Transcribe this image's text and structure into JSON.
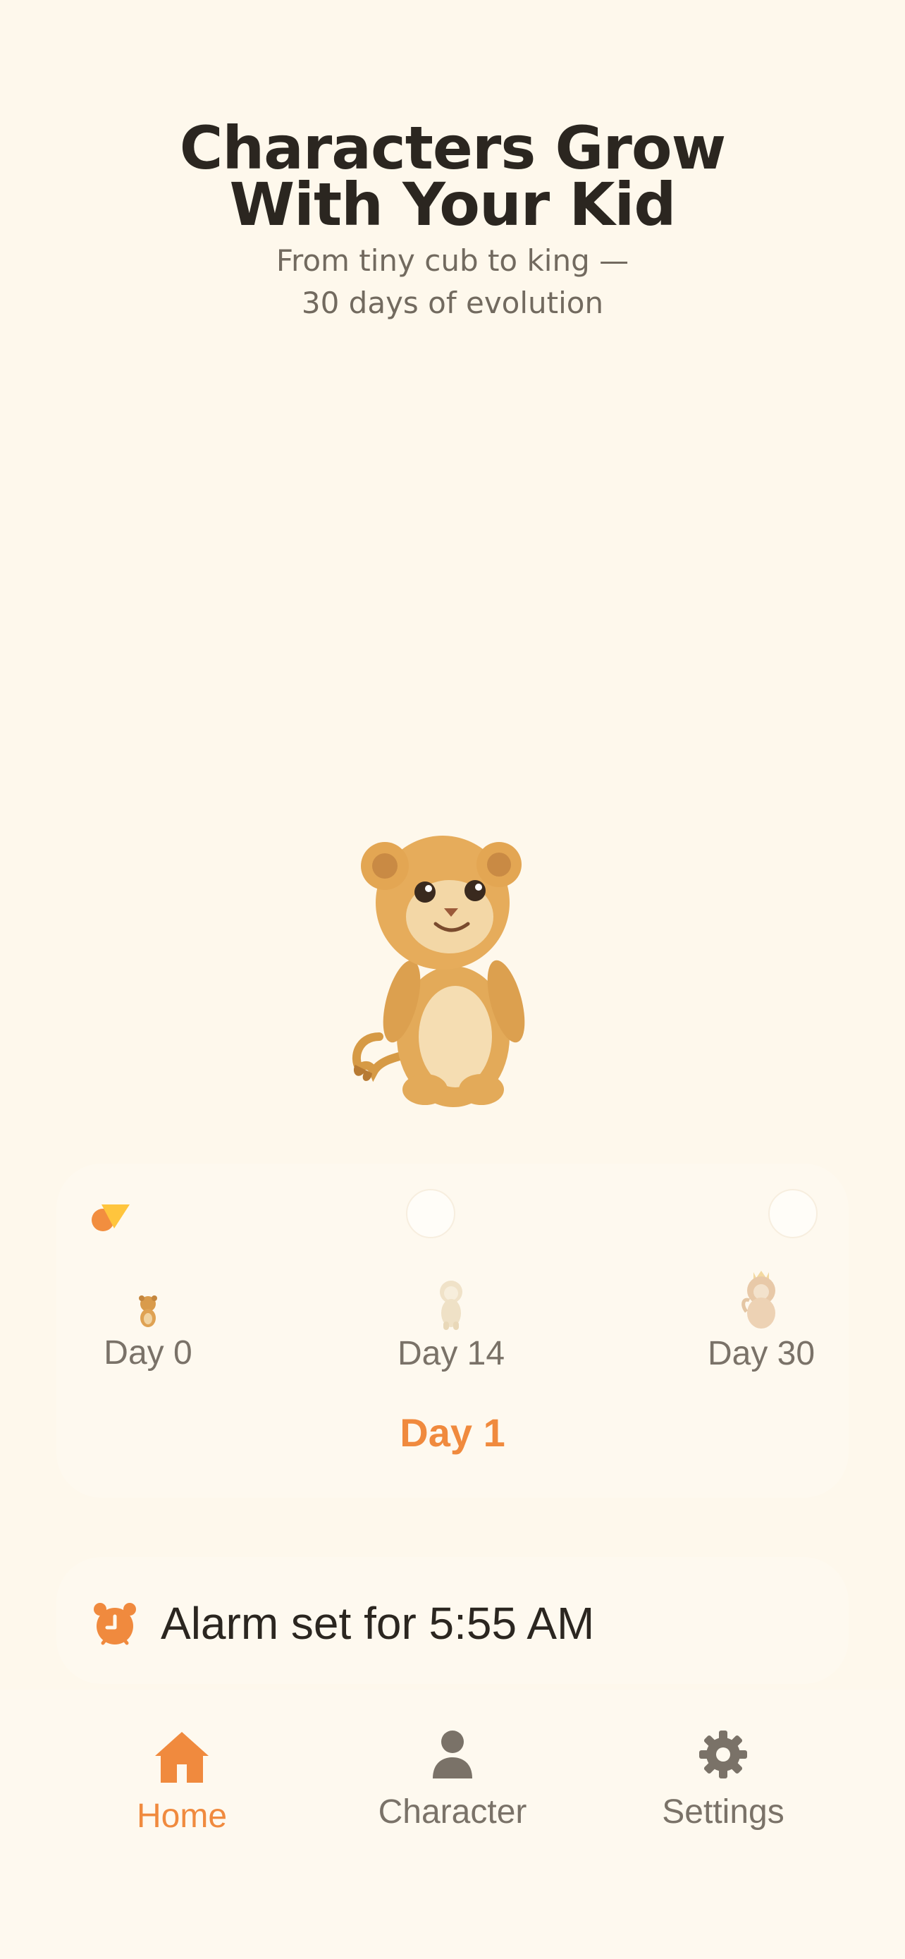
{
  "hero": {
    "title_line1": "Characters Grow",
    "title_line2": "With Your Kid",
    "subtitle_line1": "From tiny cub to king —",
    "subtitle_line2": "30 days of evolution"
  },
  "progress": {
    "current_day": 1,
    "total_days": 30,
    "current_label": "Day 1",
    "stages": [
      {
        "label": "Day 0",
        "icon": "lion-cub-icon"
      },
      {
        "label": "Day 14",
        "icon": "young-lion-icon"
      },
      {
        "label": "Day 30",
        "icon": "king-lion-icon"
      }
    ]
  },
  "alarm": {
    "text": "Alarm set for 5:55 AM",
    "icon": "alarm-clock-icon"
  },
  "tabs": [
    {
      "label": "Home",
      "icon": "home-icon",
      "active": true
    },
    {
      "label": "Character",
      "icon": "person-icon",
      "active": false
    },
    {
      "label": "Settings",
      "icon": "gear-icon",
      "active": false
    }
  ],
  "colors": {
    "background": "#FEF8EC",
    "accent": "#F08A3E",
    "title": "#2B2620",
    "muted": "#7A7268"
  }
}
